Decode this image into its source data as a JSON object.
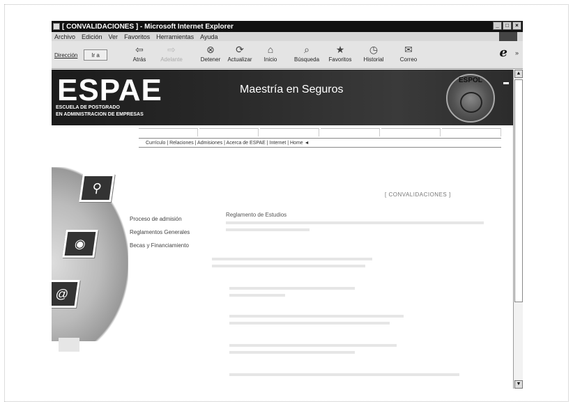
{
  "window": {
    "title": "[ CONVALIDACIONES ] - Microsoft Internet Explorer",
    "controls": [
      "_",
      "□",
      "×"
    ]
  },
  "menu": [
    "Archivo",
    "Edición",
    "Ver",
    "Favoritos",
    "Herramientas",
    "Ayuda"
  ],
  "toolbar": {
    "address_label": "Dirección",
    "go_label": "Ir a",
    "buttons": [
      {
        "label": "Atrás",
        "icon": "back-arrow-icon",
        "glyph": "⇦"
      },
      {
        "label": "Adelante",
        "icon": "forward-arrow-icon",
        "glyph": "⇨",
        "disabled": true
      },
      {
        "label": "Detener",
        "icon": "stop-icon",
        "glyph": "⊗"
      },
      {
        "label": "Actualizar",
        "icon": "refresh-icon",
        "glyph": "⟳"
      },
      {
        "label": "Inicio",
        "icon": "home-icon",
        "glyph": "⌂"
      },
      {
        "label": "Búsqueda",
        "icon": "search-icon",
        "glyph": "⌕"
      },
      {
        "label": "Favoritos",
        "icon": "favorites-icon",
        "glyph": "★"
      },
      {
        "label": "Historial",
        "icon": "history-icon",
        "glyph": "◷"
      },
      {
        "label": "Correo",
        "icon": "mail-icon",
        "glyph": "✉"
      }
    ],
    "ie_logo": "e",
    "more": "»"
  },
  "banner": {
    "logo": "ESPAE",
    "logo_sub_1": "ESCUELA DE POSTGRADO",
    "logo_sub_2": "EN ADMINISTRACION DE EMPRESAS",
    "title": "Maestría en Seguros",
    "seal_text": "ESPOL"
  },
  "subnav": {
    "text": "Currículo | Relaciones | Admisiones | Acerca de ESPAE | Internet | Home ◄"
  },
  "section_heading": "[ CONVALIDACIONES ]",
  "side_menu": [
    "Proceso de admisión",
    "Reglamentos Generales",
    "Becas y Financiamiento"
  ],
  "main_title": "Reglamento de Estudios",
  "scroll": {
    "up": "▲",
    "down": "▼"
  }
}
